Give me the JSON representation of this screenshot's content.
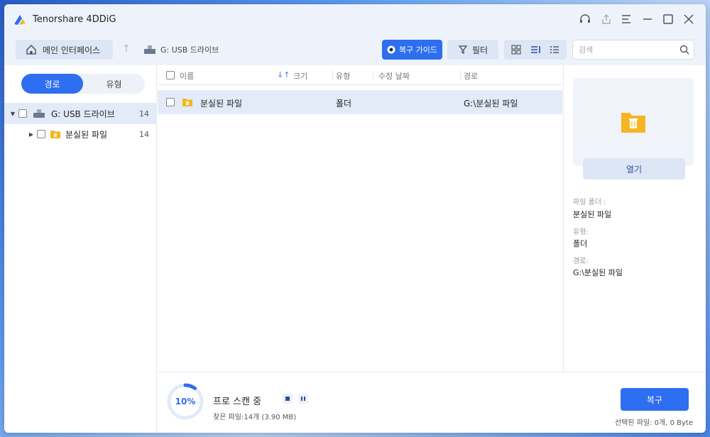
{
  "app": {
    "title": "Tenorshare 4DDiG"
  },
  "toolbar": {
    "home_label": "메인 인터페이스",
    "breadcrumb": "G: USB 드라이브",
    "guide_label": "복구 가이드",
    "filter_label": "필터",
    "search_placeholder": "검색"
  },
  "sidebar": {
    "tabs": [
      {
        "label": "경로"
      },
      {
        "label": "유형"
      }
    ],
    "tree": [
      {
        "label": "G: USB 드라이브",
        "count": "14"
      },
      {
        "label": "분실된 파일",
        "count": "14"
      }
    ]
  },
  "list": {
    "columns": {
      "name": "이름",
      "size": "크기",
      "type": "유형",
      "modified": "수정 날짜",
      "path": "경로"
    },
    "rows": [
      {
        "name": "분실된 파일",
        "size": "",
        "type": "폴더",
        "modified": "",
        "path": "G:\\분실된 파일"
      }
    ]
  },
  "details": {
    "open_label": "열기",
    "folder_label": "파일 폴더 :",
    "folder_value": "분실된 파일",
    "type_label": "유형:",
    "type_value": "폴더",
    "path_label": "경로:",
    "path_value": "G:\\분실된 파일"
  },
  "scan": {
    "progress_percent": "10%",
    "progress_value": 0.1,
    "title": "프로 스캔 중",
    "found": "찾은 파일:14개 (3.90 MB)"
  },
  "footer": {
    "recover_label": "복구",
    "selected_info": "선택된 파일: 0개, 0 Byte"
  },
  "colors": {
    "accent": "#2e6ef0",
    "folder": "#f6b523",
    "selected_row": "#e3ebf9"
  },
  "icons": [
    "app-logo-icon",
    "headset-icon",
    "share-icon",
    "menu-icon",
    "minimize-icon",
    "maximize-icon",
    "close-icon",
    "home-icon",
    "up-arrow-icon",
    "usb-drive-icon",
    "guide-icon",
    "filter-icon",
    "grid-view-icon",
    "detail-view-icon",
    "list-view-icon",
    "search-icon",
    "folder-icon",
    "sort-icon",
    "stop-icon",
    "pause-icon"
  ]
}
